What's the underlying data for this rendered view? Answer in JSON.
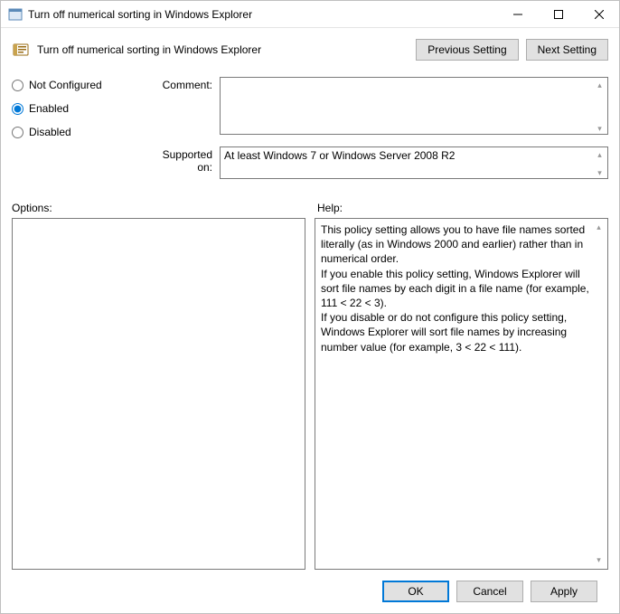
{
  "window": {
    "title": "Turn off numerical sorting in Windows Explorer"
  },
  "header": {
    "title": "Turn off numerical sorting in Windows Explorer",
    "prev": "Previous Setting",
    "next": "Next Setting"
  },
  "state": {
    "options": [
      {
        "label": "Not Configured",
        "value": "not",
        "checked": false
      },
      {
        "label": "Enabled",
        "value": "enabled",
        "checked": true
      },
      {
        "label": "Disabled",
        "value": "disabled",
        "checked": false
      }
    ]
  },
  "fields": {
    "comment_label": "Comment:",
    "comment_value": "",
    "supported_label": "Supported on:",
    "supported_value": "At least Windows 7 or Windows Server 2008 R2"
  },
  "sections": {
    "options_label": "Options:",
    "help_label": "Help:"
  },
  "help_text": "This policy setting allows you to have file names sorted literally (as in Windows 2000 and earlier) rather than in numerical order.\nIf you enable this policy setting, Windows Explorer will sort file names by each digit in a file name (for example, 111 < 22 < 3).\nIf you disable or do not configure this policy setting, Windows Explorer will sort file names by increasing number value (for example, 3 < 22 < 111).",
  "footer": {
    "ok": "OK",
    "cancel": "Cancel",
    "apply": "Apply"
  }
}
